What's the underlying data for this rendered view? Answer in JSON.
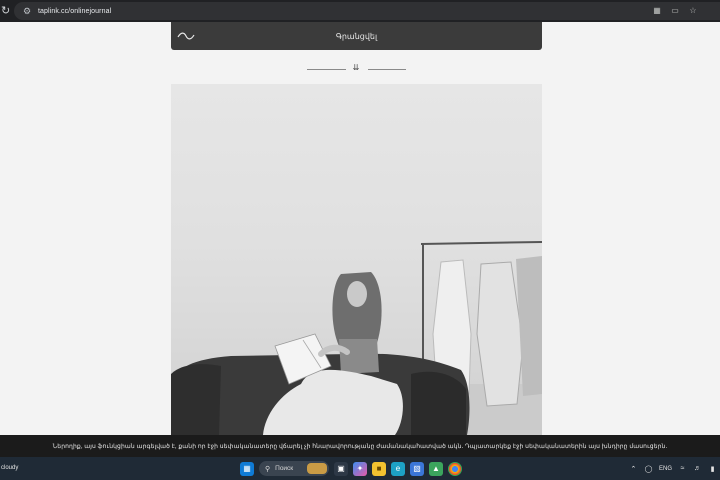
{
  "browser": {
    "url": "taplink.cc/onlinejournal",
    "icons": [
      "reload-icon",
      "site-info-icon",
      "translate-icon",
      "cast-icon",
      "bookmark-star-icon"
    ]
  },
  "header": {
    "title": "Գրանցվել",
    "logo_icon": "wave-logo-icon"
  },
  "page": {
    "scroll_icon": "double-chevron-down-icon",
    "photo": {
      "description_icon": "woman-reading-magazine-photo",
      "filter": "grayscale"
    }
  },
  "cookie_banner": {
    "text": "Ներողիք, այս ֆունկցիան արգելված է, քանի որ էջի սեփականատերը վճարել չի հնարավորությանը ժամանակահատված ակն. Դպյատարկեք էջի սեփականատերին այս խնդիրը մասուցերն."
  },
  "taskbar": {
    "weather": "cloudy",
    "search_label": "Поиск",
    "language": "ENG",
    "colors": {
      "taskbar_bg": "#1f2a36",
      "banner_bg": "#1b1b1b",
      "header_bg": "#3b3b3b"
    }
  }
}
